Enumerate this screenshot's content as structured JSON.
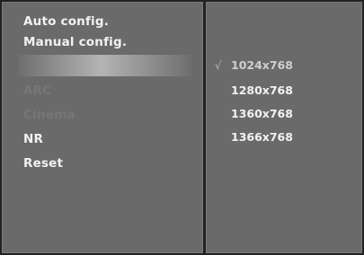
{
  "menu": {
    "items": [
      {
        "label": "Auto config.",
        "state": "active"
      },
      {
        "label": "Manual config.",
        "state": "active"
      },
      {
        "label": "",
        "state": "highlighted"
      },
      {
        "label": "ARC",
        "state": "disabled"
      },
      {
        "label": "Cinema",
        "state": "disabled"
      },
      {
        "label": "NR",
        "state": "active"
      },
      {
        "label": "Reset",
        "state": "active"
      }
    ]
  },
  "resolution": {
    "check_mark": "√",
    "options": [
      {
        "label": "1024x768",
        "selected": true
      },
      {
        "label": "1280x768",
        "selected": false
      },
      {
        "label": "1360x768",
        "selected": false
      },
      {
        "label": "1366x768",
        "selected": false
      }
    ]
  },
  "colors": {
    "panel_bg": "#6a6a6a",
    "active_text": "#f2f2f2",
    "disabled_text": "#767676"
  }
}
